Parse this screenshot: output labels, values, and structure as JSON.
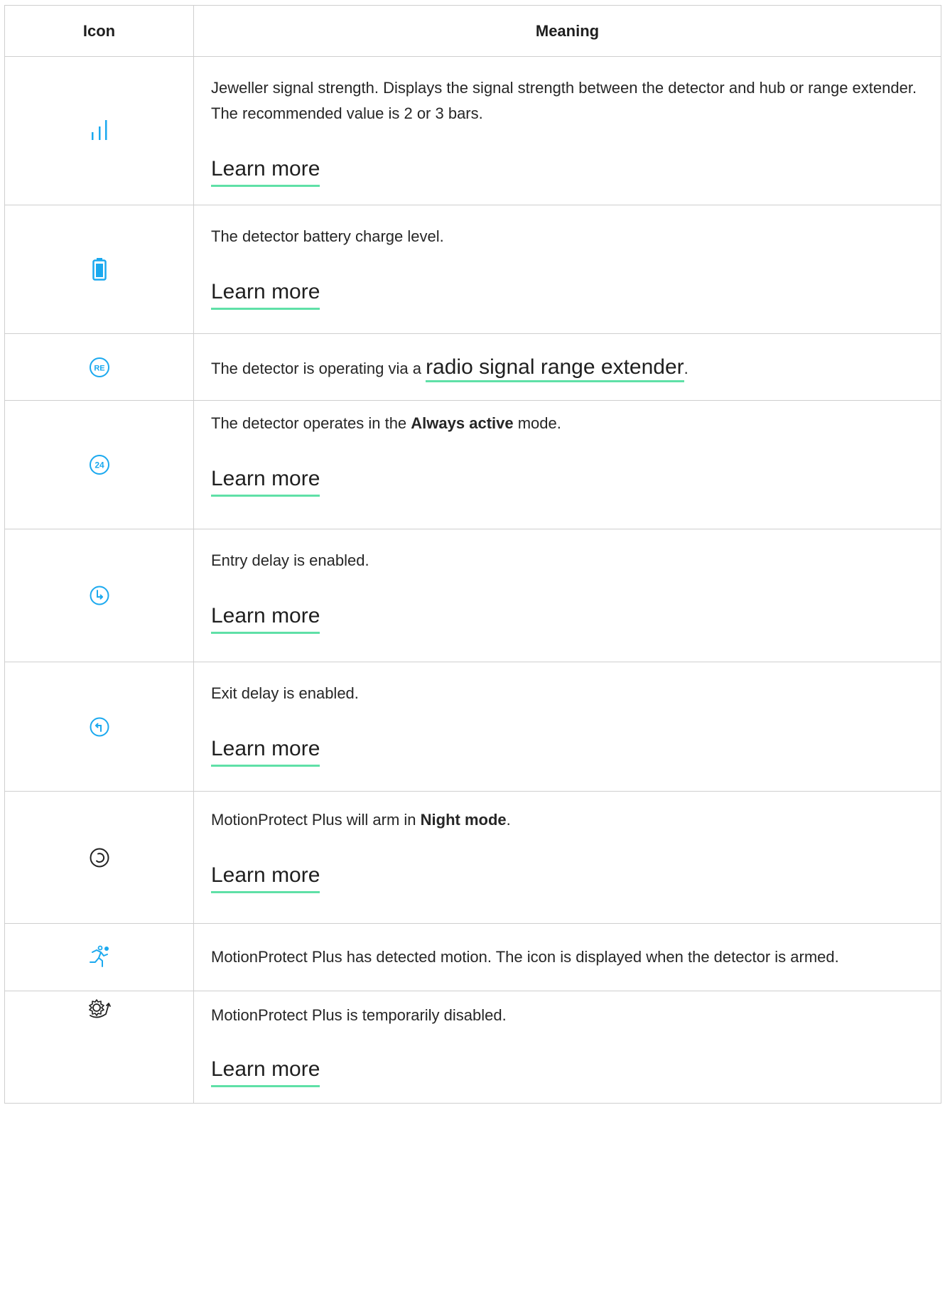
{
  "header": {
    "col_icon": "Icon",
    "col_meaning": "Meaning"
  },
  "accent_color": "#1ba9ef",
  "link_underline_color": "#5fe0a7",
  "rows": [
    {
      "icon": "signal-strength-icon",
      "text": "Jeweller signal strength. Displays the signal strength between the detector and hub or range extender. The recommended value is 2 or 3 bars.",
      "link": "Learn more"
    },
    {
      "icon": "battery-icon",
      "text": "The detector battery charge level.",
      "link": "Learn more"
    },
    {
      "icon": "range-extender-re-icon",
      "text_before": "The detector is operating via a ",
      "link": "radio signal range extender",
      "text_after": "."
    },
    {
      "icon": "always-active-24-icon",
      "text_before": "The detector operates in the ",
      "bold": "Always active",
      "text_after": " mode.",
      "link": "Learn more"
    },
    {
      "icon": "entry-delay-icon",
      "text": "Entry delay is enabled.",
      "link": "Learn more"
    },
    {
      "icon": "exit-delay-icon",
      "text": "Exit delay is enabled.",
      "link": "Learn more"
    },
    {
      "icon": "night-mode-icon",
      "text_before": "MotionProtect Plus will arm in ",
      "bold": "Night mode",
      "text_after": ".",
      "link": "Learn more"
    },
    {
      "icon": "motion-detected-icon",
      "text": "MotionProtect Plus has detected motion. The icon is displayed when the detector is armed."
    },
    {
      "icon": "temporarily-disabled-icon",
      "text": "MotionProtect Plus is temporarily disabled.",
      "link": "Learn more"
    }
  ]
}
